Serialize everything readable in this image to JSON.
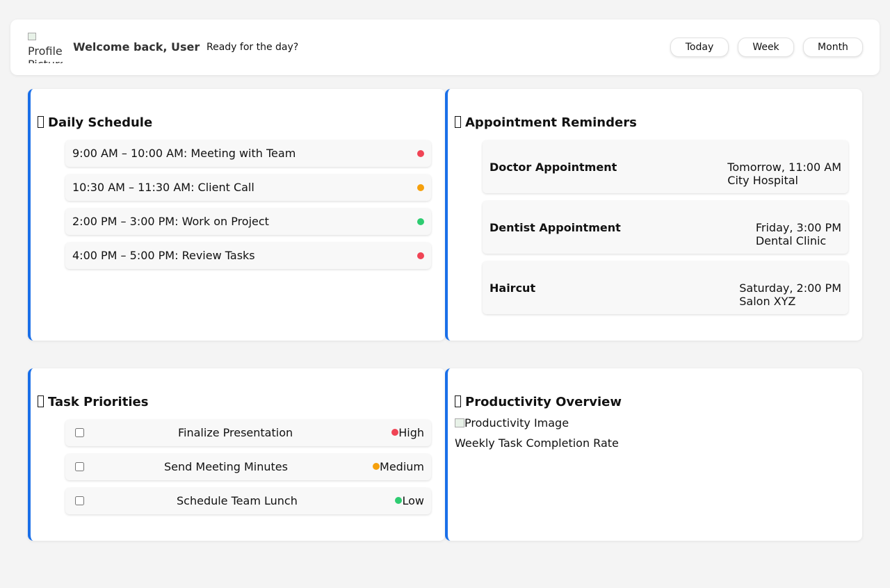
{
  "header": {
    "avatar_alt": "Profile Picture",
    "welcome": "Welcome back, User",
    "tagline": "Ready for the day?",
    "views": [
      "Today",
      "Week",
      "Month"
    ]
  },
  "schedule": {
    "title": "Daily Schedule",
    "items": [
      {
        "text": "9:00 AM – 10:00 AM: Meeting with Team",
        "status_color": "#f04455"
      },
      {
        "text": "10:30 AM – 11:30 AM: Client Call",
        "status_color": "#f5a00c"
      },
      {
        "text": "2:00 PM – 3:00 PM: Work on Project",
        "status_color": "#2ecc71"
      },
      {
        "text": "4:00 PM – 5:00 PM: Review Tasks",
        "status_color": "#f04455"
      }
    ]
  },
  "appointments": {
    "title": "Appointment Reminders",
    "items": [
      {
        "name": "Doctor Appointment",
        "when": "Tomorrow, 11:00 AM",
        "where": "City Hospital"
      },
      {
        "name": "Dentist Appointment",
        "when": "Friday, 3:00 PM",
        "where": "Dental Clinic"
      },
      {
        "name": "Haircut",
        "when": "Saturday, 2:00 PM",
        "where": "Salon XYZ"
      }
    ]
  },
  "tasks": {
    "title": "Task Priorities",
    "items": [
      {
        "name": "Finalize Presentation",
        "priority": "High",
        "color": "#f04455",
        "checked": false
      },
      {
        "name": "Send Meeting Minutes",
        "priority": "Medium",
        "color": "#f5a00c",
        "checked": false
      },
      {
        "name": "Schedule Team Lunch",
        "priority": "Low",
        "color": "#2ecc71",
        "checked": false
      }
    ]
  },
  "productivity": {
    "title": "Productivity Overview",
    "image_alt": "Productivity Image",
    "caption": "Weekly Task Completion Rate"
  },
  "colors": {
    "accent": "#1a6fe8"
  },
  "icons": {
    "card_title_icon": "missing-glyph-icon"
  }
}
